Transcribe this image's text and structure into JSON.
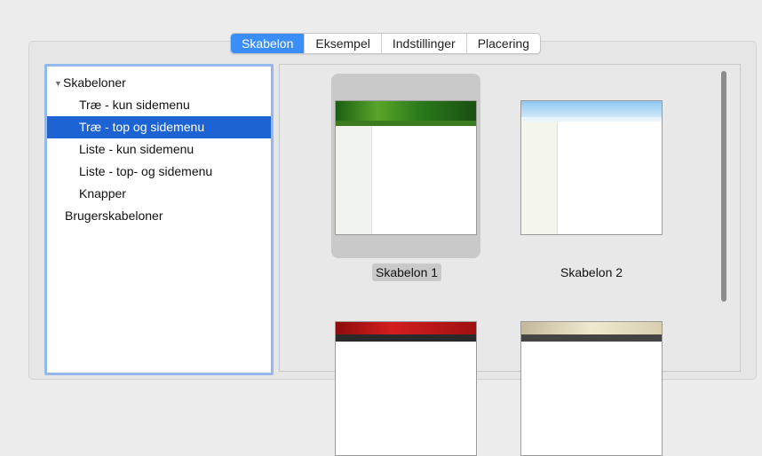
{
  "tabs": [
    {
      "label": "Skabelon",
      "active": true
    },
    {
      "label": "Eksempel",
      "active": false
    },
    {
      "label": "Indstillinger",
      "active": false
    },
    {
      "label": "Placering",
      "active": false
    }
  ],
  "tree": {
    "root_label": "Skabeloner",
    "items": [
      {
        "label": "Træ - kun sidemenu",
        "selected": false
      },
      {
        "label": "Træ - top og sidemenu",
        "selected": true
      },
      {
        "label": "Liste - kun sidemenu",
        "selected": false
      },
      {
        "label": "Liste - top- og sidemenu",
        "selected": false
      },
      {
        "label": "Knapper",
        "selected": false
      }
    ],
    "user_templates_label": "Brugerskabeloner"
  },
  "gallery": {
    "templates": [
      {
        "label": "Skabelon 1",
        "selected": true
      },
      {
        "label": "Skabelon 2",
        "selected": false
      }
    ]
  },
  "colors": {
    "accent": "#3a8ef6",
    "selection": "#1e63d4"
  }
}
